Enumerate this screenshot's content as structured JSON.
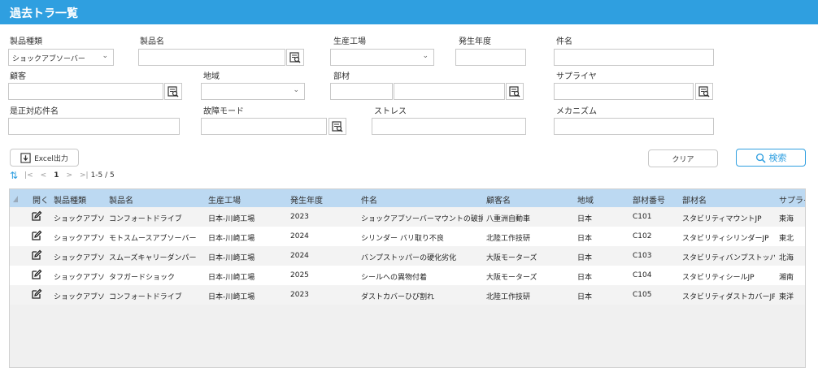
{
  "title": "過去トラ一覧",
  "filters": {
    "product_type_label": "製品種類",
    "product_type_value": "ショックアブソーバー",
    "product_name_label": "製品名",
    "factory_label": "生産工場",
    "year_label": "発生年度",
    "subject_label": "件名",
    "customer_label": "顧客",
    "region_label": "地域",
    "part_label": "部材",
    "supplier_label": "サプライヤ",
    "corrective_label": "是正対応件名",
    "failure_mode_label": "故障モード",
    "stress_label": "ストレス",
    "mechanism_label": "メカニズム"
  },
  "actions": {
    "excel_label": "Excel出力",
    "clear_label": "クリア",
    "search_label": "検索"
  },
  "pager": {
    "first": "|<",
    "prev": "<",
    "page": "1",
    "next": ">",
    "last": ">|",
    "range": "1-5 / 5"
  },
  "grid": {
    "headers": [
      "開く",
      "製品種類",
      "製品名",
      "生産工場",
      "発生年度",
      "件名",
      "顧客名",
      "地域",
      "部材番号",
      "部材名",
      "サプライ"
    ],
    "rows": [
      [
        "ショックアブソーバー",
        "コンフォートドライブ",
        "日本-川崎工場",
        "2023",
        "ショックアブソーバーマウントの破損",
        "八重洲自動車",
        "日本",
        "C101",
        "スタビリティマウントJP",
        "東海"
      ],
      [
        "ショックアブソーバー",
        "モトスムースアブソーバー",
        "日本-川崎工場",
        "2024",
        "シリンダー バリ取り不良",
        "北陸工作技研",
        "日本",
        "C102",
        "スタビリティシリンダーJP",
        "東北"
      ],
      [
        "ショックアブソーバー",
        "スムーズキャリーダンパー",
        "日本-川崎工場",
        "2024",
        "バンプストッパーの硬化劣化",
        "大阪モーターズ",
        "日本",
        "C103",
        "スタビリティバンプストッパーJP",
        "北海"
      ],
      [
        "ショックアブソーバー",
        "タフガードショック",
        "日本-川崎工場",
        "2025",
        "シールへの異物付着",
        "大阪モーターズ",
        "日本",
        "C104",
        "スタビリティシールJP",
        "湘南"
      ],
      [
        "ショックアブソーバー",
        "コンフォートドライブ",
        "日本-川崎工場",
        "2023",
        "ダストカバーひび割れ",
        "北陸工作技研",
        "日本",
        "C105",
        "スタビリティダストカバーJP",
        "東洋"
      ]
    ]
  }
}
